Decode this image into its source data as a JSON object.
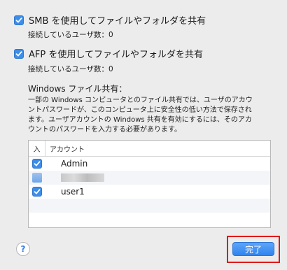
{
  "smb": {
    "label": "SMB を使用してファイルやフォルダを共有",
    "checked": true,
    "connected_users": "接続しているユーザ数：0"
  },
  "afp": {
    "label": "AFP を使用してファイルやフォルダを共有",
    "checked": true,
    "connected_users": "接続しているユーザ数：0"
  },
  "windows": {
    "title": "Windows ファイル共有：",
    "description_lines": [
      "一部の Windows コンピュータとのファイル共有では、ユーザのアカウ",
      "ントパスワードが、このコンピュータ上に安全性の低い方法で保存され",
      "ます。ユーザアカウントの Windows 共有を有効にするには、そのアカ",
      "ウントのパスワードを入力する必要があります。"
    ]
  },
  "table": {
    "col_enabled": "入",
    "col_account": "アカウント",
    "rows": [
      {
        "account": "Admin",
        "checked": true
      },
      {
        "account": "",
        "checked": true
      },
      {
        "account": "user1",
        "checked": true
      }
    ]
  },
  "buttons": {
    "help": "?",
    "done": "完了"
  },
  "colors": {
    "accent": "#3b8eea",
    "highlight": "#e01a1a",
    "background": "#ececec"
  }
}
